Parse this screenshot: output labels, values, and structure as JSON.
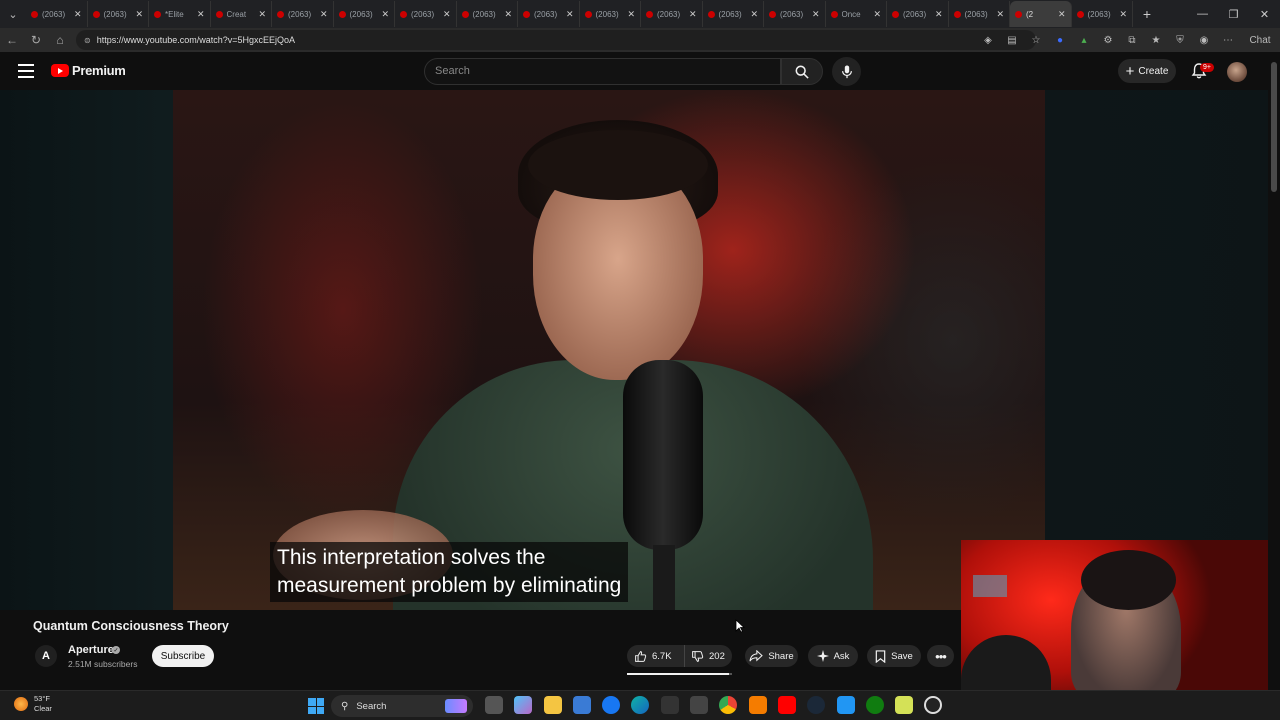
{
  "browser": {
    "tabs": [
      {
        "label": "(2063)"
      },
      {
        "label": "(2063)"
      },
      {
        "label": "*Elite"
      },
      {
        "label": "Creat"
      },
      {
        "label": "(2063)"
      },
      {
        "label": "(2063)"
      },
      {
        "label": "(2063)"
      },
      {
        "label": "(2063)"
      },
      {
        "label": "(2063)"
      },
      {
        "label": "(2063)"
      },
      {
        "label": "(2063)"
      },
      {
        "label": "(2063)"
      },
      {
        "label": "(2063)"
      },
      {
        "label": "Once"
      },
      {
        "label": "(2063)"
      },
      {
        "label": "(2063)"
      },
      {
        "label": "(2"
      },
      {
        "label": "(2063)"
      }
    ],
    "url": "https://www.youtube.com/watch?v=5HgxcEEjQoA",
    "chat_label": "Chat"
  },
  "youtube": {
    "logo_text": "Premium",
    "search_placeholder": "Search",
    "create_label": "Create",
    "notification_badge": "9+"
  },
  "video": {
    "subtitle_line1": "This interpretation solves the",
    "subtitle_line2": "measurement problem by eliminating",
    "title": "Quantum Consciousness Theory",
    "channel_initial": "A",
    "channel_name": "Aperture",
    "subscribers": "2.51M subscribers",
    "subscribe_label": "Subscribe",
    "likes": "6.7K",
    "dislikes": "202",
    "share_label": "Share",
    "ask_label": "Ask",
    "save_label": "Save"
  },
  "taskbar": {
    "temperature": "53°F",
    "condition": "Clear",
    "search_label": "Search"
  },
  "colors": {
    "brand_red": "#ff0000",
    "background": "#0f0f0f",
    "pill": "#272727"
  }
}
